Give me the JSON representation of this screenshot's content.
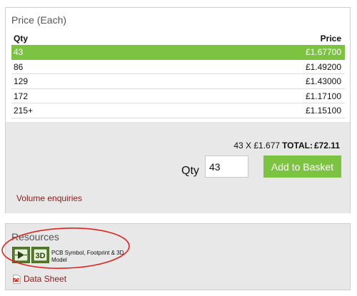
{
  "price_panel": {
    "title": "Price (Each)",
    "col_qty": "Qty",
    "col_price": "Price",
    "tiers": [
      {
        "qty": "43",
        "price": "£1.67700",
        "selected": true
      },
      {
        "qty": "86",
        "price": "£1.49200",
        "selected": false
      },
      {
        "qty": "129",
        "price": "£1.43000",
        "selected": false
      },
      {
        "qty": "172",
        "price": "£1.17100",
        "selected": false
      },
      {
        "qty": "215+",
        "price": "£1.15100",
        "selected": false
      }
    ],
    "calc": {
      "summary": "43 X £1.677",
      "total_label": "TOTAL:",
      "total_value": "£72.11"
    },
    "qty_label": "Qty",
    "qty_value": "43",
    "add_button": "Add to Basket",
    "volume_link": "Volume enquiries"
  },
  "resources": {
    "title": "Resources",
    "pcb_icon_label": "3D",
    "pcb_text": "PCB Symbol, Footprint & 3D Model",
    "datasheet_label": "Data Sheet"
  },
  "colors": {
    "accent_green": "#7cc342",
    "link_red": "#8b1a1a",
    "panel_grey": "#e8e8e8",
    "annotation_red": "#e0221f"
  },
  "icons": [
    "pcb-symbol-icon",
    "3d-model-icon",
    "pdf-icon"
  ]
}
